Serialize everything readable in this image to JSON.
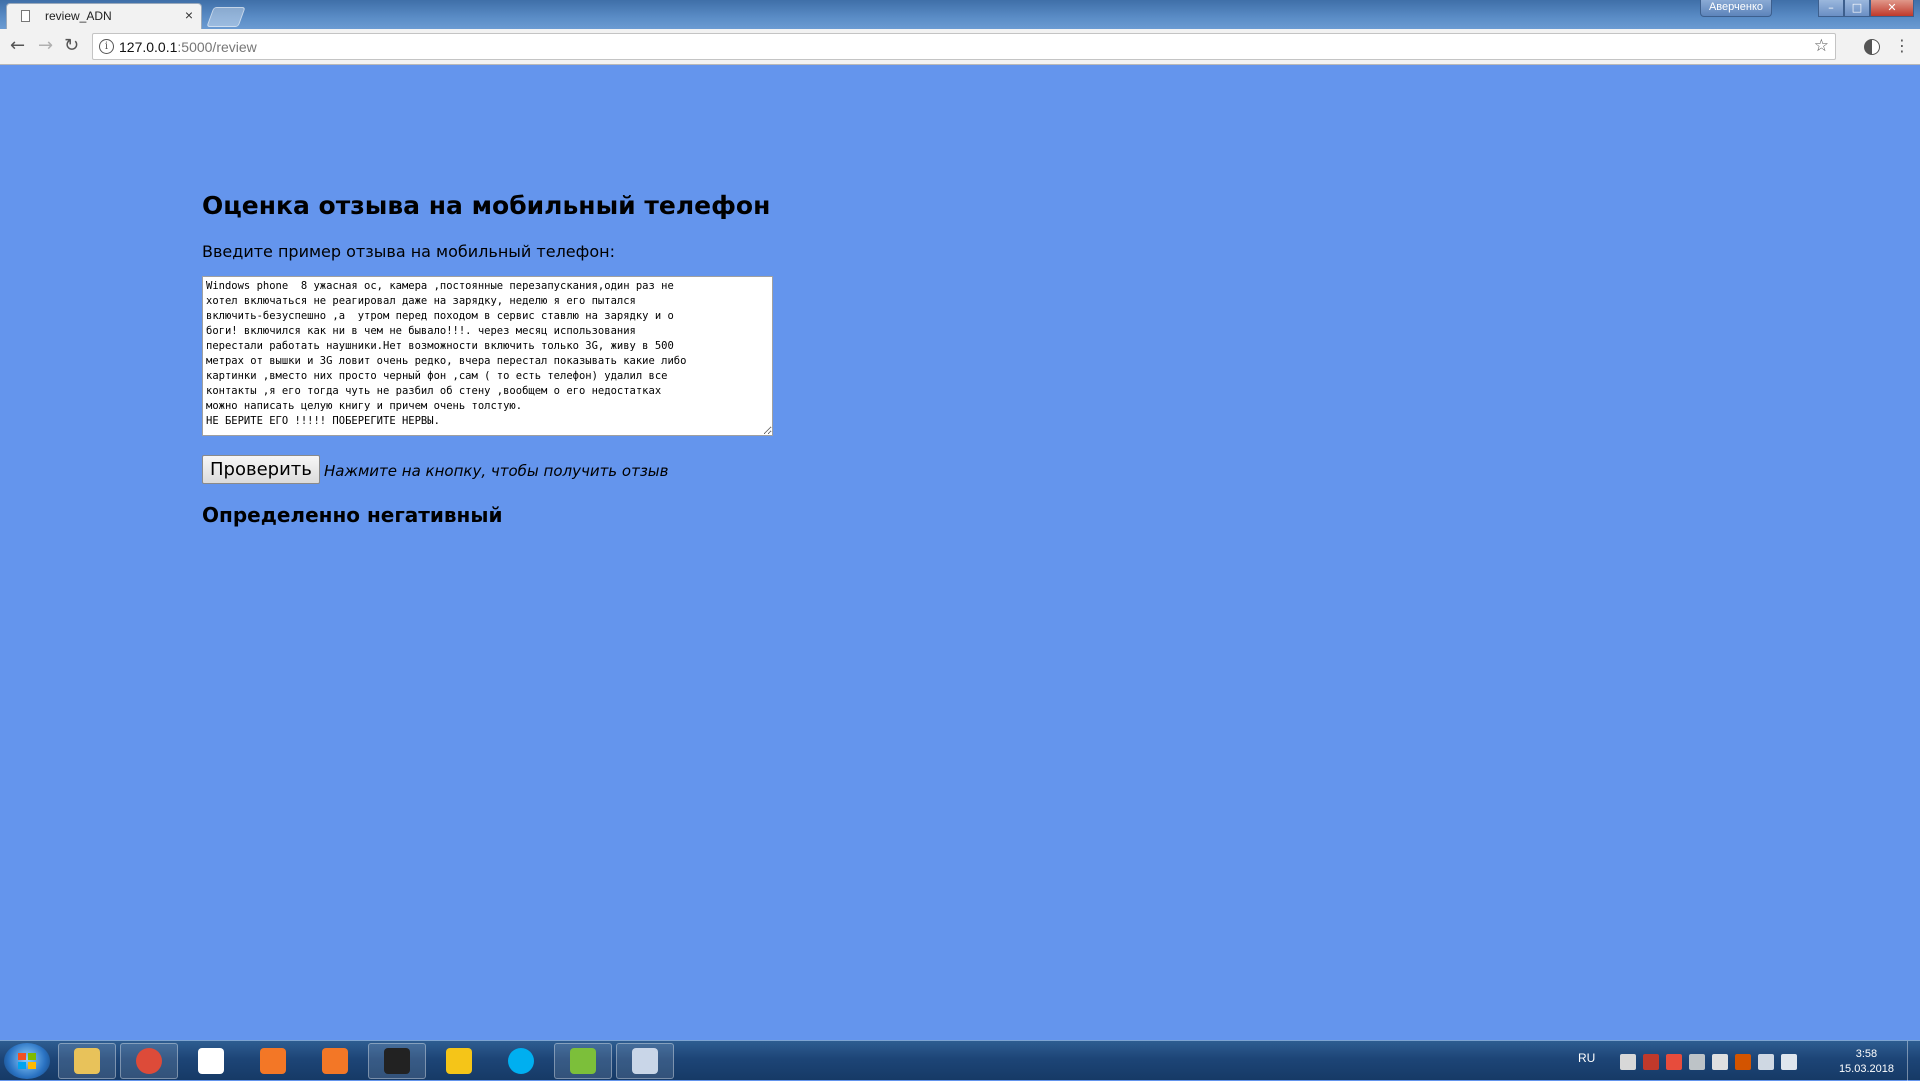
{
  "browser": {
    "tab_title": "review_ADN",
    "tab_close": "×",
    "profile_name": "Аверченко",
    "url_host": "127.0.0.1",
    "url_rest": ":5000/review",
    "back_glyph": "←",
    "forward_glyph": "→",
    "reload_glyph": "↻",
    "star_glyph": "☆",
    "menu_glyph": "⋮",
    "info_glyph": "i",
    "minimize_glyph": "–",
    "maximize_glyph": "□",
    "close_glyph": "✕"
  },
  "page": {
    "background": "#6495ED",
    "title": "Оценка отзыва на мобильный телефон",
    "prompt": "Введите пример отзыва на мобильный телефон:",
    "review_text": "Windows phone  8 ужасная ос, камера ,постоянные перезапускания,один раз не\nхотел включаться не реагировал даже на зарядку, неделю я его пытался\nвключить-безуспешно ,а  утром перед походом в сервис ставлю на зарядку и о\nбоги! включился как ни в чем не бывало!!!. через месяц использования\nперестали работать наушники.Нет возможности включить только 3G, живу в 500\nметрах от вышки и 3G ловит очень редко, вчера перестал показывать какие либо\nкартинки ,вместо них просто черный фон ,сам ( то есть телефон) удалил все\nконтакты ,я его тогда чуть не разбил об стену ,вообщем о его недостатках\nможно написать целую книгу и причем очень толстую.\nНЕ БЕРИТЕ ЕГО !!!!! ПОБЕРЕГИТЕ НЕРВЫ.",
    "check_button": "Проверить",
    "hint": "Нажмите на кнопку, чтобы получить отзыв",
    "result": "Определенно негативный"
  },
  "taskbar": {
    "apps": [
      {
        "name": "explorer-icon",
        "color": "#e8c25a"
      },
      {
        "name": "chrome-icon",
        "color": "#dd4b39"
      },
      {
        "name": "yandex-browser-icon",
        "color": "#ffffff"
      },
      {
        "name": "jupyter-icon",
        "color": "#f37726"
      },
      {
        "name": "jupyter-icon-2",
        "color": "#f37726"
      },
      {
        "name": "terminal-icon",
        "color": "#222222"
      },
      {
        "name": "smiley-app-icon",
        "color": "#f5c518"
      },
      {
        "name": "skype-icon",
        "color": "#00aff0"
      },
      {
        "name": "notepad-icon",
        "color": "#7cbf3a"
      },
      {
        "name": "paint-icon",
        "color": "#c9d6e8"
      }
    ],
    "language": "RU",
    "time": "3:58",
    "date": "15.03.2018"
  }
}
